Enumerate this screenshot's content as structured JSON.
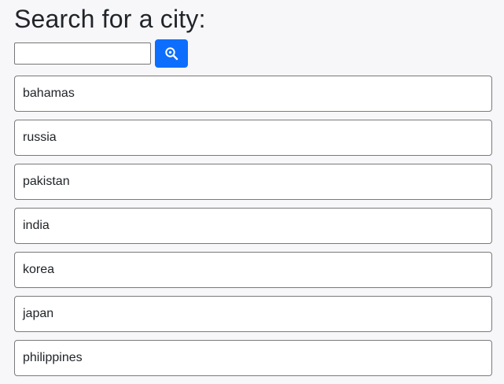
{
  "header": {
    "title": "Search for a city:"
  },
  "search": {
    "value": "",
    "placeholder": "",
    "button_icon": "search-icon",
    "button_color": "#0d6efd"
  },
  "results": [
    {
      "label": "bahamas"
    },
    {
      "label": "russia"
    },
    {
      "label": "pakistan"
    },
    {
      "label": "india"
    },
    {
      "label": "korea"
    },
    {
      "label": "japan"
    },
    {
      "label": "philippines"
    }
  ]
}
